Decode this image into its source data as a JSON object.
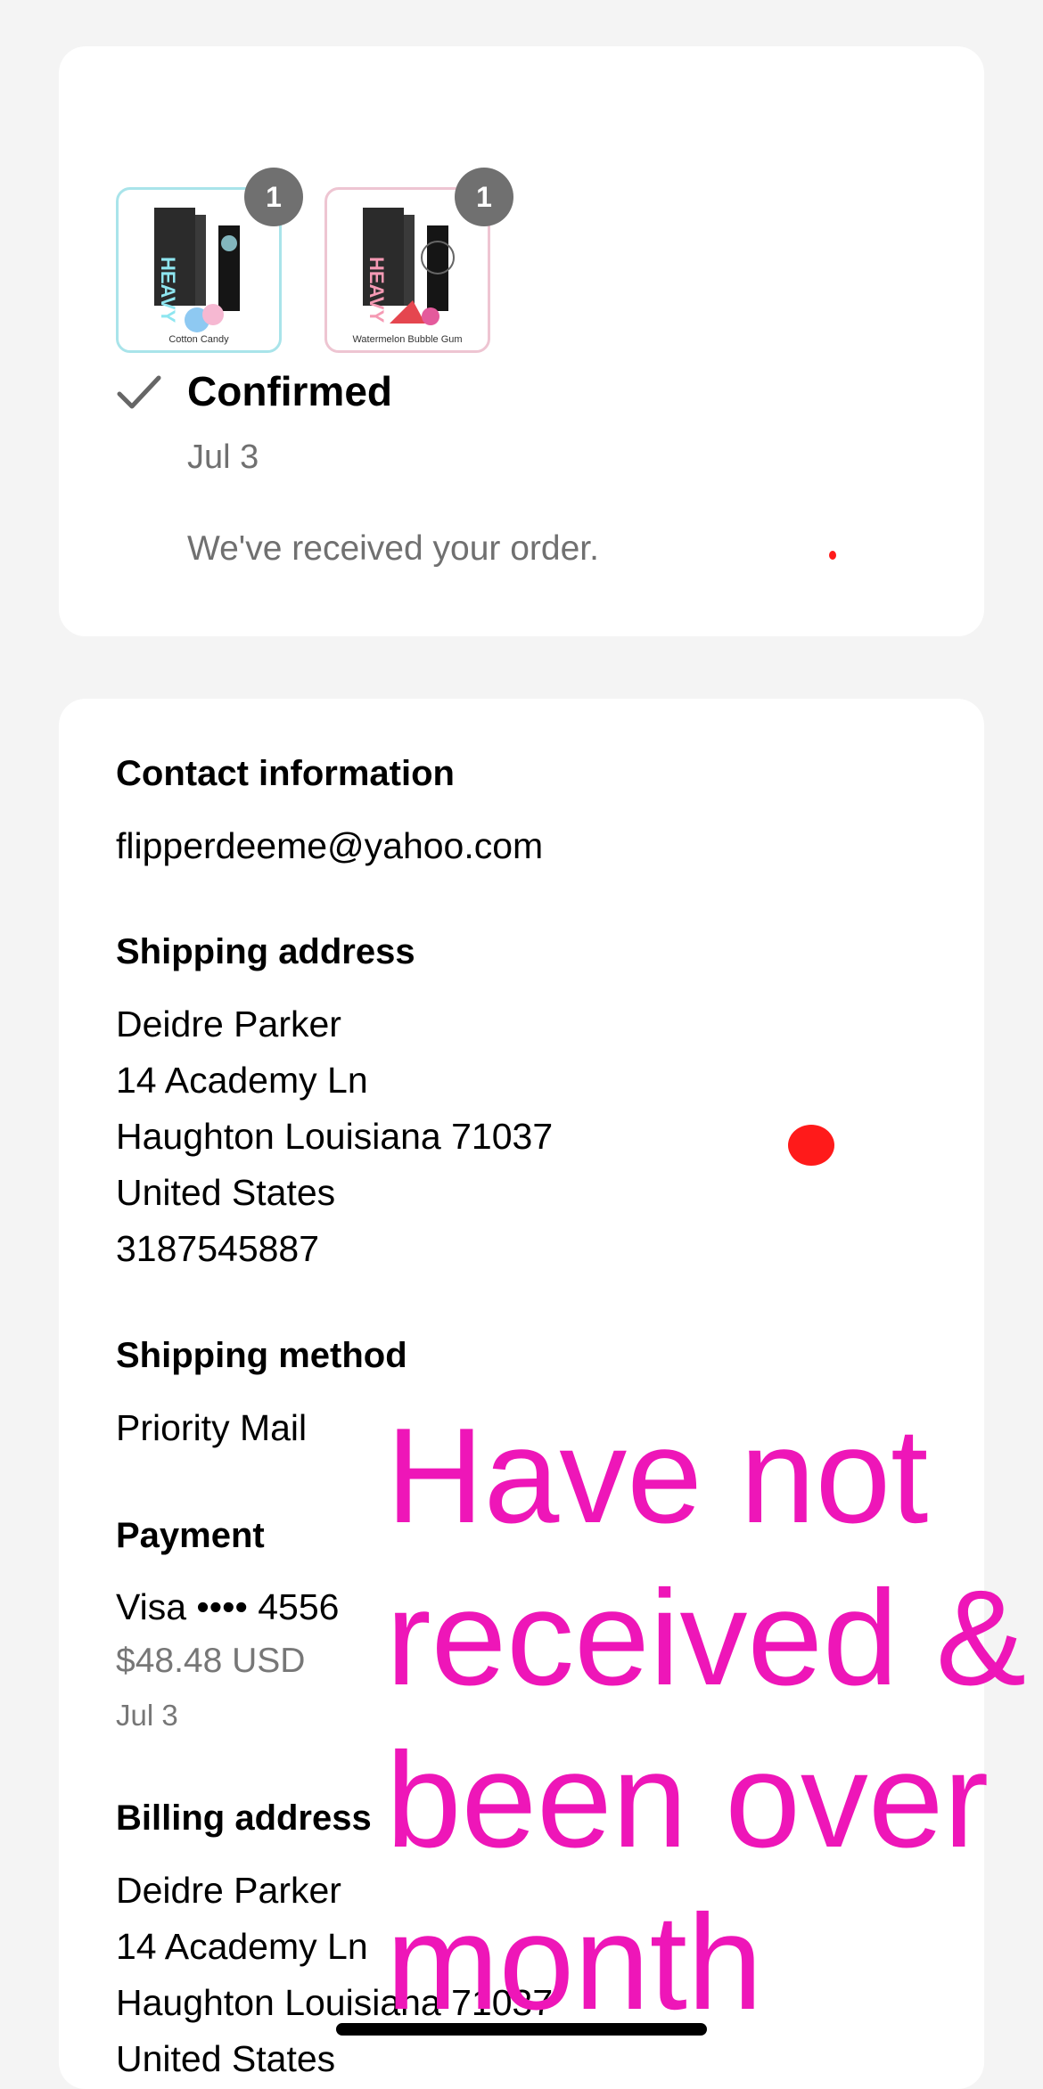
{
  "order_status": {
    "items": [
      {
        "label": "Cotton Candy",
        "quantity": "1",
        "border_color": "#a9e4ea"
      },
      {
        "label": "Watermelon Bubble Gum",
        "quantity": "1",
        "border_color": "#eec5d2"
      }
    ],
    "product_brand": "HEAVY",
    "status_title": "Confirmed",
    "status_date": "Jul 3",
    "status_message": "We've received your order."
  },
  "details": {
    "contact": {
      "heading": "Contact information",
      "email": "flipperdeeme@yahoo.com"
    },
    "shipping_address": {
      "heading": "Shipping address",
      "lines": [
        "Deidre Parker",
        "14 Academy Ln",
        "Haughton Louisiana 71037",
        "United States",
        "3187545887"
      ]
    },
    "shipping_method": {
      "heading": "Shipping method",
      "value": "Priority Mail"
    },
    "payment": {
      "heading": "Payment",
      "card": "Visa •••• 4556",
      "amount": "$48.48 USD",
      "date": "Jul 3"
    },
    "billing_address": {
      "heading": "Billing address",
      "lines": [
        "Deidre Parker",
        "14 Academy Ln",
        "Haughton Louisiana 71037",
        "United States"
      ]
    }
  },
  "annotation": {
    "text": "Have not\nreceived &\nbeen over\nmonth",
    "color": "#ee16b8"
  },
  "colors": {
    "background": "#f4f4f4",
    "card": "#ffffff",
    "secondary_text": "#707070",
    "badge": "#707070"
  }
}
